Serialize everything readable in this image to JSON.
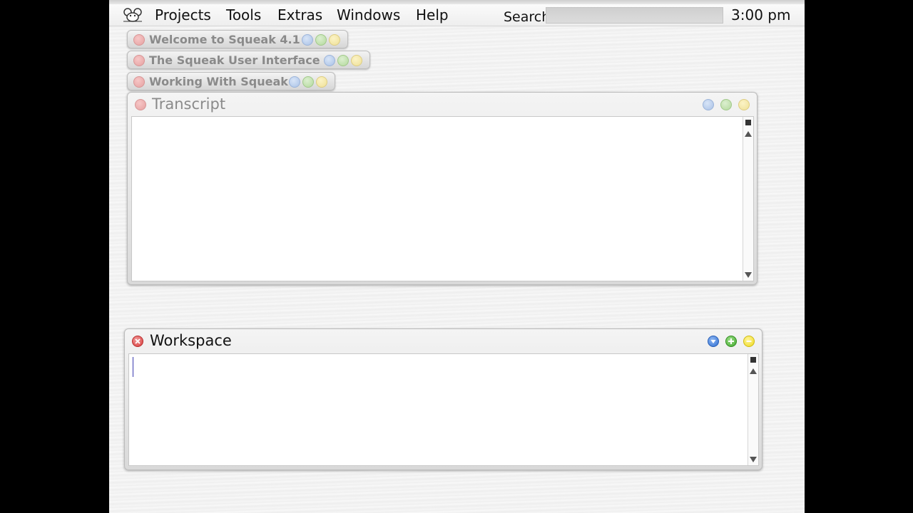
{
  "menubar": {
    "logo_icon": "squeak-mouse-icon",
    "items": [
      "Projects",
      "Tools",
      "Extras",
      "Windows",
      "Help"
    ],
    "search_label": "Search",
    "search_value": "",
    "clock": "3:00 pm"
  },
  "collapsed_windows": [
    {
      "title": "Welcome to Squeak 4.1"
    },
    {
      "title": "The Squeak User Interface"
    },
    {
      "title": "Working With Squeak"
    }
  ],
  "transcript": {
    "title": "Transcript",
    "content": ""
  },
  "workspace": {
    "title": "Workspace",
    "content": ""
  },
  "colors": {
    "close": "#d83b3b",
    "menu": "#2f6fd2",
    "grow": "#3ea62a",
    "collapse": "#efd81d",
    "inactive_title": "#8a8a8a",
    "active_title": "#111111"
  }
}
